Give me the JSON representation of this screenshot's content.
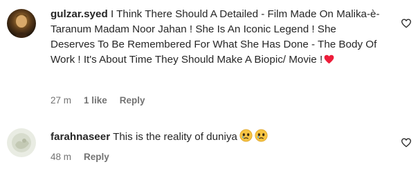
{
  "comments": [
    {
      "username": "gulzar.syed",
      "text": "I Think There Should A Detailed - Film Made On Malika-è-Taranum Madam Noor Jahan ! She Is An Iconic Legend ! She Deserves To Be Remembered For What She Has Done - The Body Of Work ! It's About Time They Should Make A Biopic/ Movie !",
      "time": "27 m",
      "likes": "1 like",
      "reply_label": "Reply",
      "emoji": "red-heart-icon"
    },
    {
      "username": "farahnaseer",
      "text": "This is the reality of duniya",
      "time": "48 m",
      "reply_label": "Reply",
      "emoji": "sad-face-icon"
    }
  ],
  "colors": {
    "text": "#262626",
    "meta": "#737373",
    "heart": "#ed4956"
  }
}
